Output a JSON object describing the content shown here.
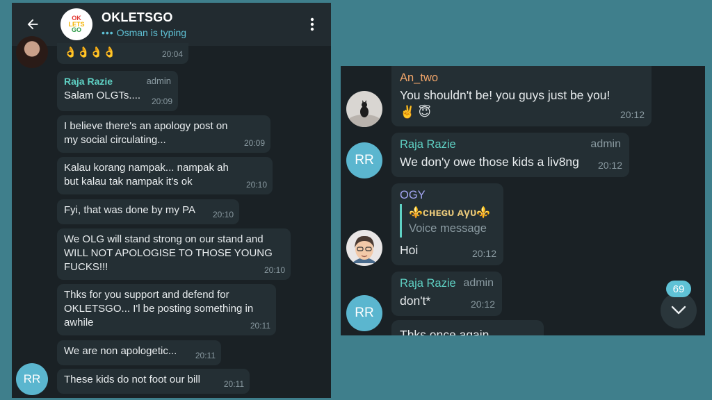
{
  "left_chat": {
    "header": {
      "title": "OKLETSGO",
      "status": "Osman is typing",
      "status_dots": "•••",
      "avatar_logo": [
        "OK",
        "LETS",
        "GO"
      ]
    },
    "messages": [
      {
        "text": "👌👌👌👌",
        "time": "20:04"
      },
      {
        "sender": "Raja Razie",
        "role": "admin",
        "text": "Salam OLGTs....",
        "time": "20:09"
      },
      {
        "text": "I believe there's an apology post on my social circulating...",
        "time": "20:09"
      },
      {
        "text": "Kalau korang nampak... nampak ah but kalau tak nampak it's ok",
        "time": "20:10"
      },
      {
        "text": "Fyi, that was done by my PA",
        "time": "20:10"
      },
      {
        "text": "We OLG will stand strong on our stand and WILL NOT APOLOGISE TO THOSE YOUNG FUCKS!!!",
        "time": "20:10"
      },
      {
        "text": "Thks for you support and defend for OKLETSGO... I'l be posting something in awhile",
        "time": "20:11"
      },
      {
        "text": "We are non apologetic...",
        "time": "20:11"
      },
      {
        "text": "These kids do not foot our bill",
        "time": "20:11"
      }
    ],
    "avatar_initials": "RR"
  },
  "right_chat": {
    "messages": [
      {
        "sender": "An_two",
        "text": "You shouldn't be! you guys just be you! ✌️ 😇",
        "time": "20:12"
      },
      {
        "sender": "Raja Razie",
        "role": "admin",
        "text": "We don'y owe those kids a liv8ng",
        "time": "20:12"
      },
      {
        "sender": "OGY",
        "reply_name": "⚜️ᴄʜᴇɢᴜ ᴀγᴜ⚜️",
        "reply_text": "Voice message",
        "text": "Hoi",
        "time": "20:12"
      },
      {
        "sender": "Raja Razie",
        "role": "admin",
        "text": "don't*",
        "time": "20:12"
      },
      {
        "text": "Thks once again"
      }
    ],
    "avatar_initials": "RR",
    "unread_count": "69"
  },
  "colors": {
    "background": "#3f7f8c",
    "chat_bg": "#1a2125",
    "bubble": "#242f34",
    "accent": "#5fc2d6",
    "sender_teal": "#5fd1c4",
    "sender_orange": "#f0a56a",
    "sender_purple": "#a4a6f3"
  },
  "icons": [
    "back-arrow-icon",
    "more-vert-icon",
    "chevron-down-icon"
  ]
}
